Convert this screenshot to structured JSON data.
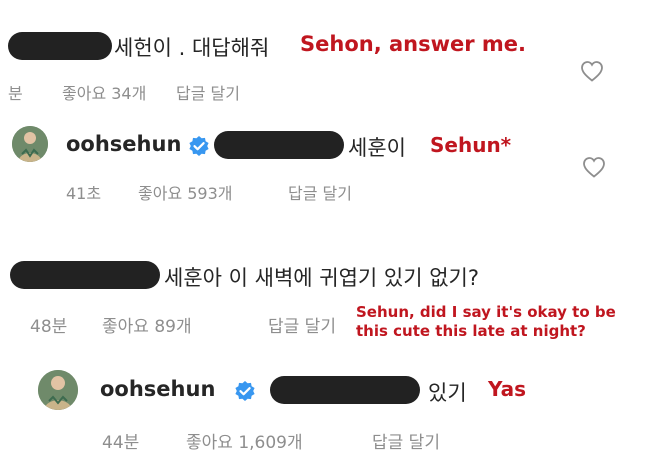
{
  "comments": [
    {
      "text": "세헌이 . 대답해줘",
      "translation": "Sehon, answer me.",
      "time": "분",
      "likes": "좋아요 34개",
      "reply": "답글 달기"
    },
    {
      "username": "oohsehun",
      "text": "세훈이",
      "translation": "Sehun*",
      "time": "41초",
      "likes": "좋아요 593개",
      "reply": "답글 달기"
    },
    {
      "text": "세훈아 이 새벽에 귀엽기 있기 없기?",
      "translation_line1": "Sehun, did I say it's okay to be",
      "translation_line2": "this cute this late at night?",
      "time": "48분",
      "likes": "좋아요 89개",
      "reply": "답글 달기"
    },
    {
      "username": "oohsehun",
      "text": "있기",
      "translation": "Yas",
      "time": "44분",
      "likes": "좋아요 1,609개",
      "reply": "답글 달기"
    }
  ],
  "colors": {
    "annotation": "#c0161f",
    "verified": "#3897f0",
    "meta": "#8e8e8e",
    "redaction": "#222222"
  },
  "icons": [
    "heart-outline-icon",
    "verified-badge-icon"
  ]
}
